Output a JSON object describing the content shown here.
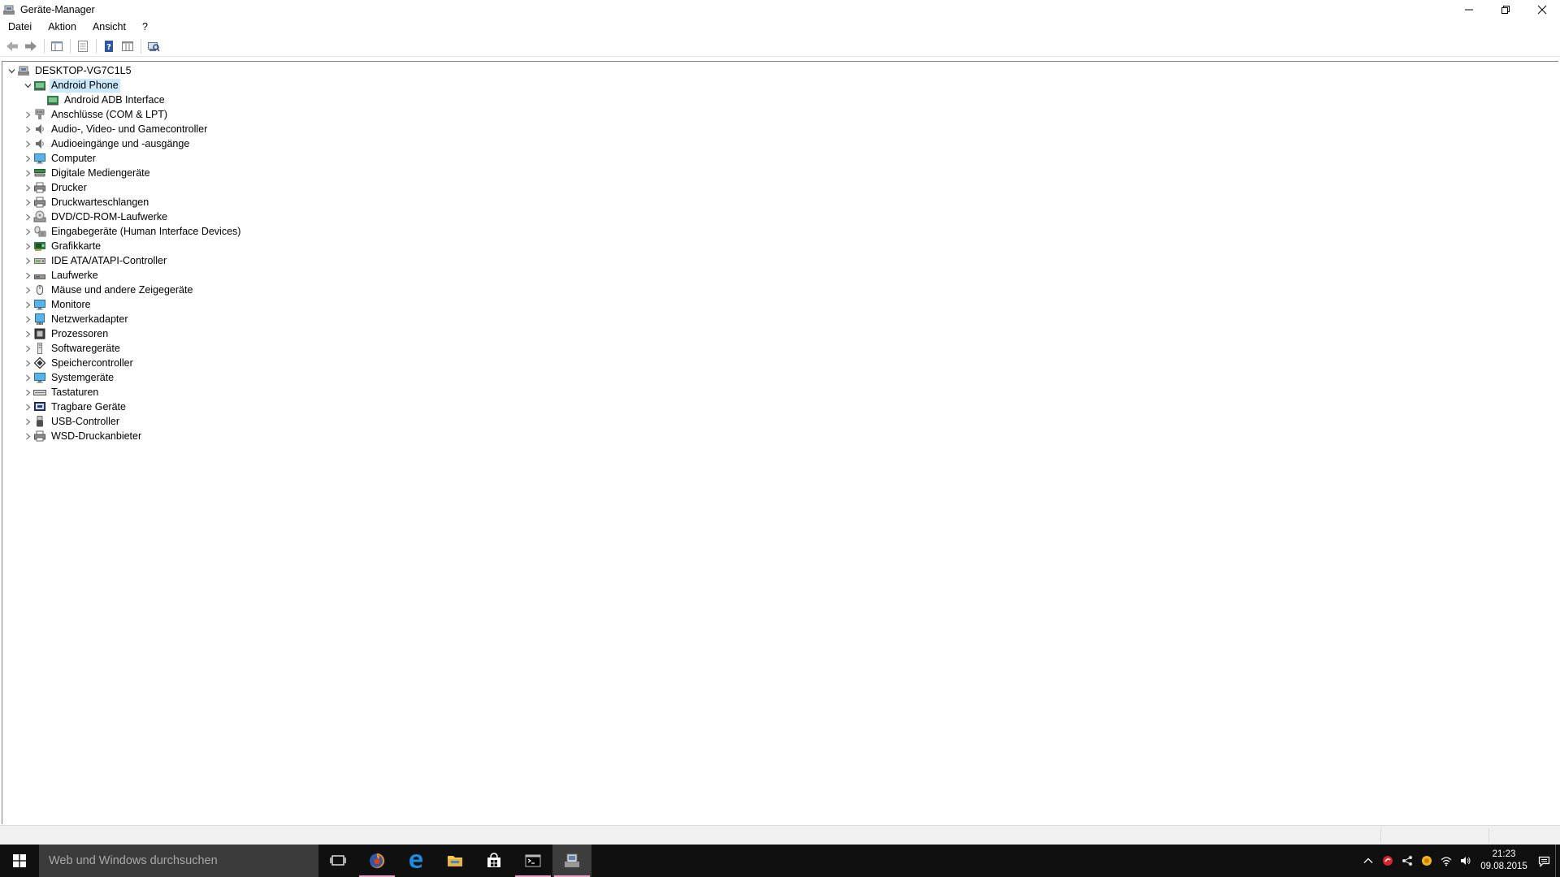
{
  "window": {
    "title": "Geräte-Manager"
  },
  "menu": {
    "items": [
      "Datei",
      "Aktion",
      "Ansicht",
      "?"
    ]
  },
  "tree": {
    "root": "DESKTOP-VG7C1L5",
    "nodes": [
      {
        "label": "Android Phone",
        "level": 1,
        "expanded": true,
        "selected": true,
        "icon": "android-phone-icon"
      },
      {
        "label": "Android ADB Interface",
        "level": 2,
        "expanded": null,
        "selected": false,
        "icon": "adb-interface-icon"
      },
      {
        "label": "Anschlüsse (COM & LPT)",
        "level": 1,
        "expanded": false,
        "icon": "port-icon"
      },
      {
        "label": "Audio-, Video- und Gamecontroller",
        "level": 1,
        "expanded": false,
        "icon": "speaker-icon"
      },
      {
        "label": "Audioeingänge und -ausgänge",
        "level": 1,
        "expanded": false,
        "icon": "speaker-icon"
      },
      {
        "label": "Computer",
        "level": 1,
        "expanded": false,
        "icon": "monitor-icon"
      },
      {
        "label": "Digitale Mediengeräte",
        "level": 1,
        "expanded": false,
        "icon": "media-device-icon"
      },
      {
        "label": "Drucker",
        "level": 1,
        "expanded": false,
        "icon": "printer-icon"
      },
      {
        "label": "Druckwarteschlangen",
        "level": 1,
        "expanded": false,
        "icon": "printer-icon"
      },
      {
        "label": "DVD/CD-ROM-Laufwerke",
        "level": 1,
        "expanded": false,
        "icon": "disc-drive-icon"
      },
      {
        "label": "Eingabegeräte (Human Interface Devices)",
        "level": 1,
        "expanded": false,
        "icon": "hid-icon"
      },
      {
        "label": "Grafikkarte",
        "level": 1,
        "expanded": false,
        "icon": "graphics-card-icon"
      },
      {
        "label": "IDE ATA/ATAPI-Controller",
        "level": 1,
        "expanded": false,
        "icon": "ide-controller-icon"
      },
      {
        "label": "Laufwerke",
        "level": 1,
        "expanded": false,
        "icon": "drive-icon"
      },
      {
        "label": "Mäuse und andere Zeigegeräte",
        "level": 1,
        "expanded": false,
        "icon": "mouse-icon"
      },
      {
        "label": "Monitore",
        "level": 1,
        "expanded": false,
        "icon": "monitor-icon"
      },
      {
        "label": "Netzwerkadapter",
        "level": 1,
        "expanded": false,
        "icon": "network-adapter-icon"
      },
      {
        "label": "Prozessoren",
        "level": 1,
        "expanded": false,
        "icon": "processor-icon"
      },
      {
        "label": "Softwaregeräte",
        "level": 1,
        "expanded": false,
        "icon": "software-device-icon"
      },
      {
        "label": "Speichercontroller",
        "level": 1,
        "expanded": false,
        "icon": "storage-controller-icon"
      },
      {
        "label": "Systemgeräte",
        "level": 1,
        "expanded": false,
        "icon": "monitor-icon"
      },
      {
        "label": "Tastaturen",
        "level": 1,
        "expanded": false,
        "icon": "keyboard-icon"
      },
      {
        "label": "Tragbare Geräte",
        "level": 1,
        "expanded": false,
        "icon": "portable-device-icon"
      },
      {
        "label": "USB-Controller",
        "level": 1,
        "expanded": false,
        "icon": "usb-icon"
      },
      {
        "label": "WSD-Druckanbieter",
        "level": 1,
        "expanded": false,
        "icon": "printer-icon"
      }
    ]
  },
  "taskbar": {
    "search_placeholder": "Web und Windows durchsuchen",
    "apps": [
      "task-view",
      "firefox",
      "edge",
      "file-explorer",
      "store",
      "command-prompt",
      "device-manager"
    ],
    "clock_time": "21:23",
    "clock_date": "09.08.2015"
  },
  "colors": {
    "selection": "#cce8ff",
    "taskbar": "#101010",
    "search_box": "#3b3b3b"
  }
}
